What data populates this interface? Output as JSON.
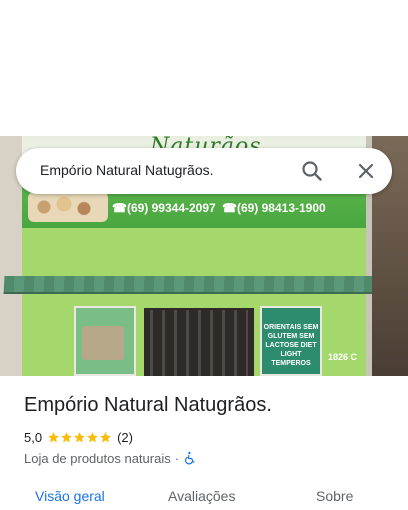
{
  "search": {
    "query": "Empório Natural Natugrãos."
  },
  "photo": {
    "sign_brand": "Naturãos",
    "phone1": "☎(69) 99344-2097",
    "phone2": "☎(69) 98413-1900",
    "window_text": "ORIENTAIS SEM GLUTEM SEM LACTOSE DIET LIGHT TEMPEROS",
    "address_number": "1826 C"
  },
  "place": {
    "title": "Empório Natural Natugrãos.",
    "rating": "5,0",
    "stars": 5,
    "reviews_count": "(2)",
    "category": "Loja de produtos naturais",
    "separator": "·"
  },
  "tabs": [
    {
      "label": "Visão geral",
      "active": true
    },
    {
      "label": "Avaliações",
      "active": false
    },
    {
      "label": "Sobre",
      "active": false
    }
  ],
  "colors": {
    "accent": "#1a73e8",
    "star": "#fbbc04",
    "accessibility": "#1a73e8"
  },
  "icons": [
    "search-icon",
    "close-icon",
    "star-icon",
    "wheelchair-icon"
  ]
}
